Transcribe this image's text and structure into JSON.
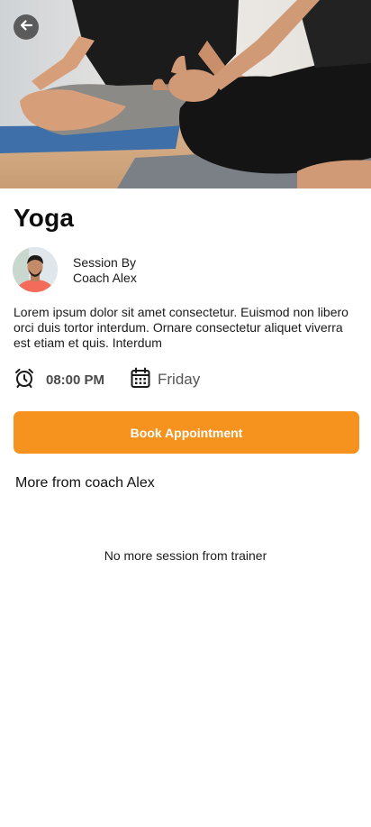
{
  "hero": {
    "image": "yoga-meditation-photo"
  },
  "header": {
    "back_icon": "arrow-left-icon"
  },
  "session": {
    "title": "Yoga",
    "session_by_label": "Session By",
    "coach_name": "Coach Alex",
    "description": "Lorem ipsum dolor sit amet consectetur. Euismod non libero orci duis tortor interdum. Ornare consectetur aliquet viverra est etiam et quis. Interdum",
    "time": "08:00 PM",
    "time_icon": "alarm-clock-icon",
    "day": "Friday",
    "day_icon": "calendar-icon"
  },
  "actions": {
    "book_label": "Book Appointment"
  },
  "more": {
    "title": "More from coach Alex",
    "empty_text": "No more session from trainer"
  },
  "colors": {
    "accent": "#f6921e",
    "back_button": "#5b5b5b"
  }
}
